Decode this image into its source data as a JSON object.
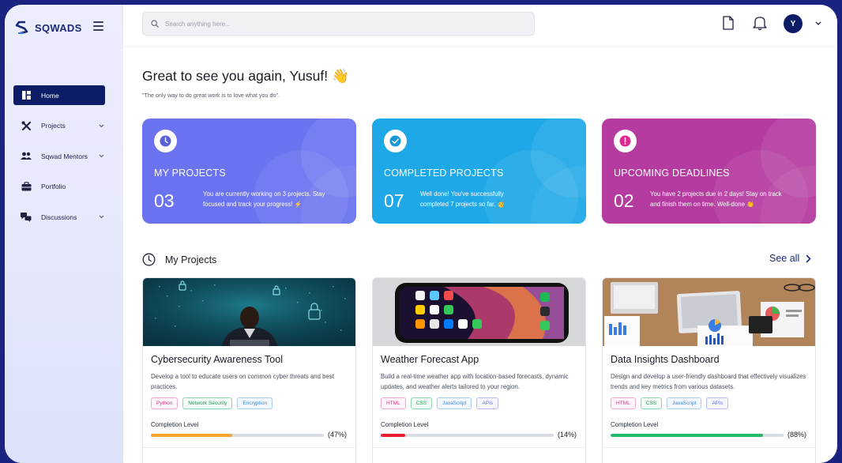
{
  "brand": {
    "name": "SQWADS"
  },
  "sidebar": {
    "items": [
      {
        "label": "Home",
        "icon": "dashboard-icon",
        "active": true
      },
      {
        "label": "Projects",
        "icon": "tools-icon",
        "has_submenu": true
      },
      {
        "label": "Sqwad Mentors",
        "icon": "people-icon",
        "has_submenu": true
      },
      {
        "label": "Portfolio",
        "icon": "briefcase-icon"
      },
      {
        "label": "Discussions",
        "icon": "chat-icon",
        "has_submenu": true
      }
    ]
  },
  "header": {
    "search_placeholder": "Search anything here...",
    "avatar_initial": "Y"
  },
  "main": {
    "greeting": "Great to see you again, Yusuf! 👋",
    "quote": "\"The only way to do great work is to love what you do\".",
    "stats": [
      {
        "title": "MY PROJECTS",
        "count": "03",
        "description": "You are currently working on 3 projects. Stay focused and track your progress! ⚡",
        "color": "#6b73f0",
        "icon": "clock-icon"
      },
      {
        "title": "COMPLETED PROJECTS",
        "count": "07",
        "description": "Well done! You've successfully completed 7 projects so far. 🥳",
        "color": "#1ea8e8",
        "icon": "check-icon"
      },
      {
        "title": "UPCOMING DEADLINES",
        "count": "02",
        "description": "You have 2 projects due in 2 days! Stay on track and finish them on time. Well-done 👏",
        "color": "#b53ba0",
        "icon": "alert-icon"
      }
    ],
    "section_title": "My Projects",
    "see_all_label": "See all",
    "projects": [
      {
        "title": "Cybersecurity Awareness Tool",
        "description": "Develop a tool to educate users on common cyber threats and best practices.",
        "tags": [
          "Python",
          "Network Security",
          "Encryption"
        ],
        "completion_label": "Completion Level",
        "completion": 47,
        "completion_text": "(47%)",
        "bar_color": "#f7a531"
      },
      {
        "title": "Weather Forecast App",
        "description": "Build a real-time weather app with location-based forecasts, dynamic updates, and weather alerts tailored to your region.",
        "tags": [
          "HTML",
          "CSS",
          "JavaScript",
          "APIs"
        ],
        "completion_label": "Completion Level",
        "completion": 14,
        "completion_text": "(14%)",
        "bar_color": "#e8202e"
      },
      {
        "title": "Data Insights Dashboard",
        "description": "Design and develop a user-friendly dashboard that effectively visualizes trends and key metrics from various datasets.",
        "tags": [
          "HTML",
          "CSS",
          "JavaScript",
          "APIs"
        ],
        "completion_label": "Completion Level",
        "completion": 88,
        "completion_text": "(88%)",
        "bar_color": "#1fba6a"
      }
    ]
  }
}
